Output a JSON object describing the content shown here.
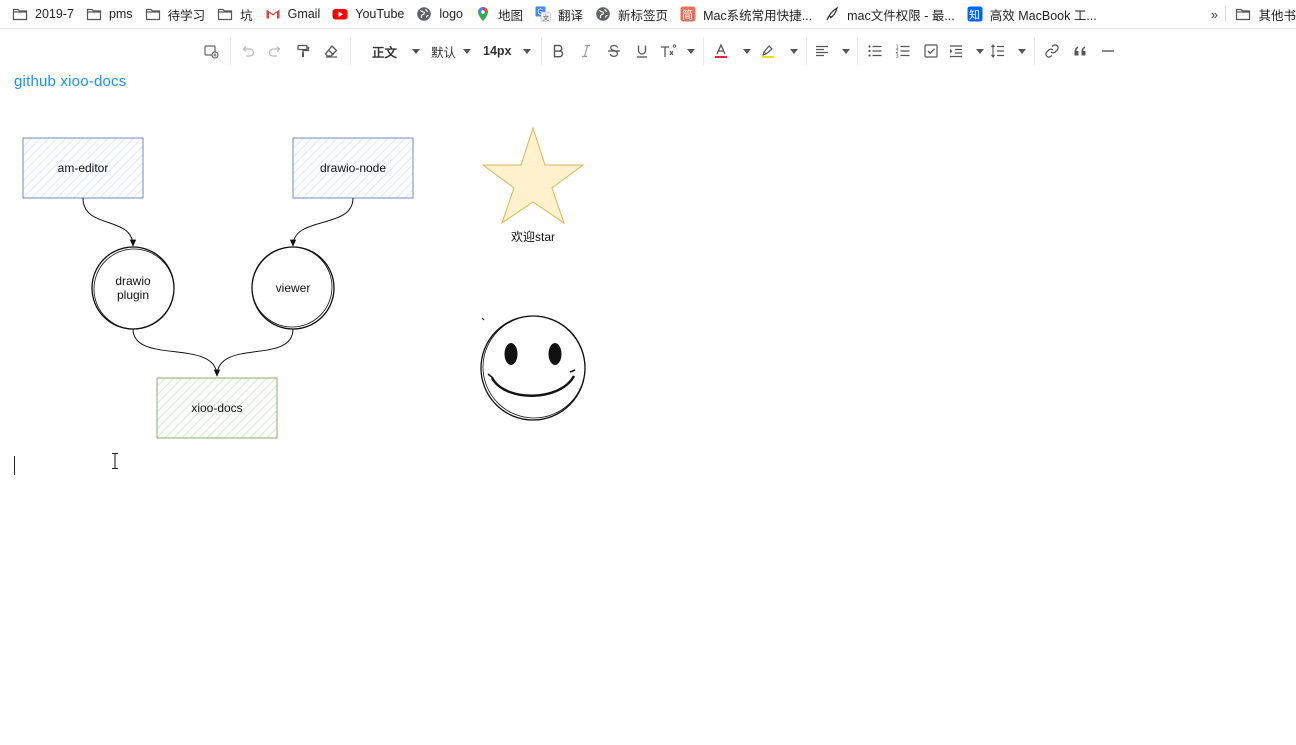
{
  "bookmarks": [
    {
      "label": "2019-7",
      "icon": "folder-icon"
    },
    {
      "label": "pms",
      "icon": "folder-icon"
    },
    {
      "label": "待学习",
      "icon": "folder-icon"
    },
    {
      "label": "坑",
      "icon": "folder-icon"
    },
    {
      "label": "Gmail",
      "icon": "gmail-icon"
    },
    {
      "label": "YouTube",
      "icon": "youtube-icon"
    },
    {
      "label": "logo",
      "icon": "globe-icon"
    },
    {
      "label": "地图",
      "icon": "maps-pin-icon"
    },
    {
      "label": "翻译",
      "icon": "translate-icon"
    },
    {
      "label": "新标签页",
      "icon": "globe-icon"
    },
    {
      "label": "Mac系统常用快捷...",
      "icon": "jian-icon"
    },
    {
      "label": "mac文件权限 - 最...",
      "icon": "feather-icon"
    },
    {
      "label": "高效 MacBook 工...",
      "icon": "zhihu-icon"
    }
  ],
  "bookmarks_more": "»",
  "other_bookmarks": "其他书",
  "toolbar": {
    "paragraph_style": "正文",
    "font_family": "默认",
    "font_size": "14px"
  },
  "editor": {
    "link_text": "github xioo-docs"
  },
  "diagram": {
    "am_editor": "am-editor",
    "drawio_node": "drawio-node",
    "drawio_plugin_line1": "drawio",
    "drawio_plugin_line2": "plugin",
    "viewer": "viewer",
    "xioo_docs": "xioo-docs",
    "star_caption": "欢迎star"
  },
  "colors": {
    "link": "#1890ff",
    "box_blue": "#6c8ebf",
    "box_green": "#82b366",
    "star_fill": "#fff2cc",
    "star_stroke": "#d6b656"
  }
}
